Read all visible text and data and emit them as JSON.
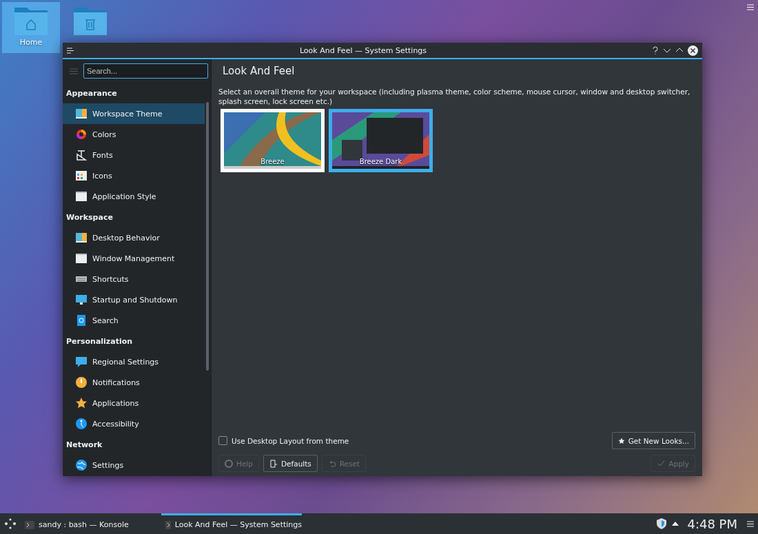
{
  "desktop": {
    "icons": [
      {
        "kind": "home",
        "label": "Home",
        "selected": true
      },
      {
        "kind": "trash",
        "selected": false
      }
    ]
  },
  "window": {
    "title": "Look And Feel — System Settings"
  },
  "sidebar": {
    "search": {
      "placeholder": "Search..."
    },
    "sections": [
      {
        "title": "Appearance",
        "items": [
          {
            "kind": "theme",
            "label": "Workspace Theme",
            "selected": true
          },
          {
            "kind": "colors",
            "label": "Colors",
            "selected": false
          },
          {
            "kind": "fonts",
            "label": "Fonts",
            "selected": false
          },
          {
            "kind": "icons",
            "label": "Icons",
            "selected": false
          },
          {
            "kind": "window",
            "label": "Application Style",
            "selected": false
          }
        ]
      },
      {
        "title": "Workspace",
        "items": [
          {
            "kind": "theme",
            "label": "Desktop Behavior",
            "selected": false
          },
          {
            "kind": "window",
            "label": "Window Management",
            "selected": false
          },
          {
            "kind": "keyboard",
            "label": "Shortcuts",
            "selected": false
          },
          {
            "kind": "monitor",
            "label": "Startup and Shutdown",
            "selected": false
          },
          {
            "kind": "search",
            "label": "Search",
            "selected": false
          }
        ]
      },
      {
        "title": "Personalization",
        "items": [
          {
            "kind": "chat",
            "label": "Regional Settings",
            "selected": false
          },
          {
            "kind": "bell",
            "label": "Notifications",
            "selected": false
          },
          {
            "kind": "star",
            "label": "Applications",
            "selected": false
          },
          {
            "kind": "access",
            "label": "Accessibility",
            "selected": false
          }
        ]
      },
      {
        "title": "Network",
        "items": [
          {
            "kind": "globe",
            "label": "Settings",
            "selected": false
          }
        ]
      }
    ]
  },
  "content": {
    "heading": "Look And Feel",
    "description": "Select an overall theme for your workspace (including plasma theme, color scheme, mouse cursor, window and desktop switcher, splash screen, lock screen etc.)",
    "themes": [
      {
        "kind": "light",
        "label": "Breeze",
        "selected": false
      },
      {
        "kind": "dark",
        "label": "Breeze Dark",
        "selected": true
      }
    ],
    "layout_checkbox": {
      "label": "Use Desktop Layout from theme",
      "checked": false
    },
    "get_new": {
      "label": "Get New Looks..."
    },
    "buttons": [
      {
        "kind": "help",
        "label": "Help",
        "disabled": true
      },
      {
        "kind": "defaults",
        "label": "Defaults",
        "disabled": false
      },
      {
        "kind": "reset",
        "label": "Reset",
        "disabled": true
      },
      {
        "kind": "apply",
        "label": "Apply",
        "disabled": true
      }
    ]
  },
  "taskbar": {
    "tasks": [
      {
        "label": "sandy : bash — Konsole",
        "selected": false
      },
      {
        "label": "Look And Feel  — System Settings",
        "selected": true
      }
    ],
    "clock": "4:48 PM"
  }
}
